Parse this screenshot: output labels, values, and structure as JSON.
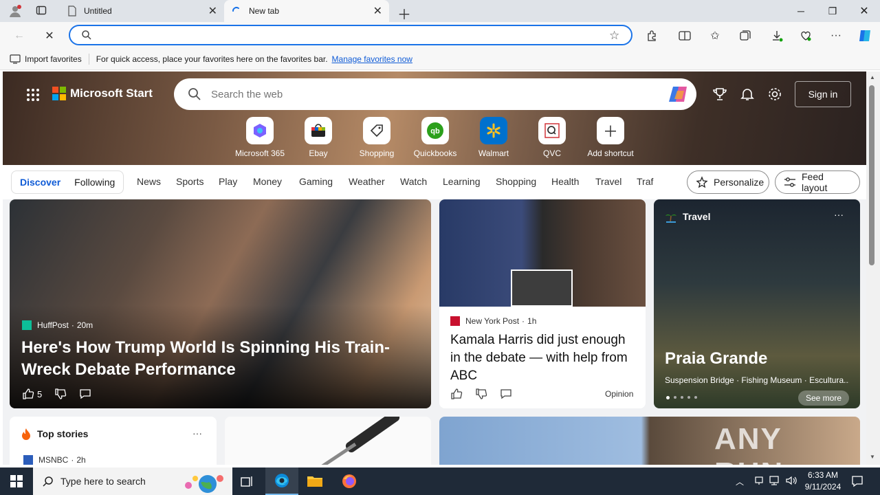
{
  "browser": {
    "tabs": [
      {
        "title": "Untitled"
      },
      {
        "title": "New tab"
      }
    ],
    "address_value": "",
    "favorites_bar": {
      "import_label": "Import favorites",
      "hint": "For quick access, place your favorites here on the favorites bar.",
      "manage_link": "Manage favorites now"
    }
  },
  "page": {
    "brand": "Microsoft Start",
    "search_placeholder": "Search the web",
    "sign_in": "Sign in",
    "shortcuts": [
      {
        "label": "Microsoft 365",
        "icon": "microsoft-365-icon"
      },
      {
        "label": "Ebay",
        "icon": "ebay-icon"
      },
      {
        "label": "Shopping",
        "icon": "shopping-tag-icon"
      },
      {
        "label": "Quickbooks",
        "icon": "quickbooks-icon"
      },
      {
        "label": "Walmart",
        "icon": "walmart-icon"
      },
      {
        "label": "QVC",
        "icon": "qvc-icon"
      },
      {
        "label": "Add shortcut",
        "icon": "plus-icon"
      }
    ],
    "feed_tabs": [
      "Discover",
      "Following"
    ],
    "categories": [
      "News",
      "Sports",
      "Play",
      "Money",
      "Gaming",
      "Weather",
      "Watch",
      "Learning",
      "Shopping",
      "Health",
      "Travel",
      "Traf"
    ],
    "personalize": "Personalize",
    "feed_layout": "Feed layout",
    "main_story": {
      "source": "HuffPost",
      "age": "20m",
      "headline": "Here's How Trump World Is Spinning His Train-Wreck Debate Performance",
      "likes": "5"
    },
    "second_story": {
      "source": "New York Post",
      "age": "1h",
      "headline": "Kamala Harris did just enough in the debate — with help from ABC",
      "tag": "Opinion"
    },
    "travel_card": {
      "section": "Travel",
      "title": "Praia Grande",
      "subtitle": "Suspension Bridge · Fishing Museum · Escultura...",
      "see_more": "See more"
    },
    "top_stories": {
      "title": "Top stories",
      "source": "MSNBC",
      "age": "2h"
    },
    "watermark": "ANY RUN"
  },
  "taskbar": {
    "search_placeholder": "Type here to search",
    "time": "6:33 AM",
    "date": "9/11/2024"
  }
}
